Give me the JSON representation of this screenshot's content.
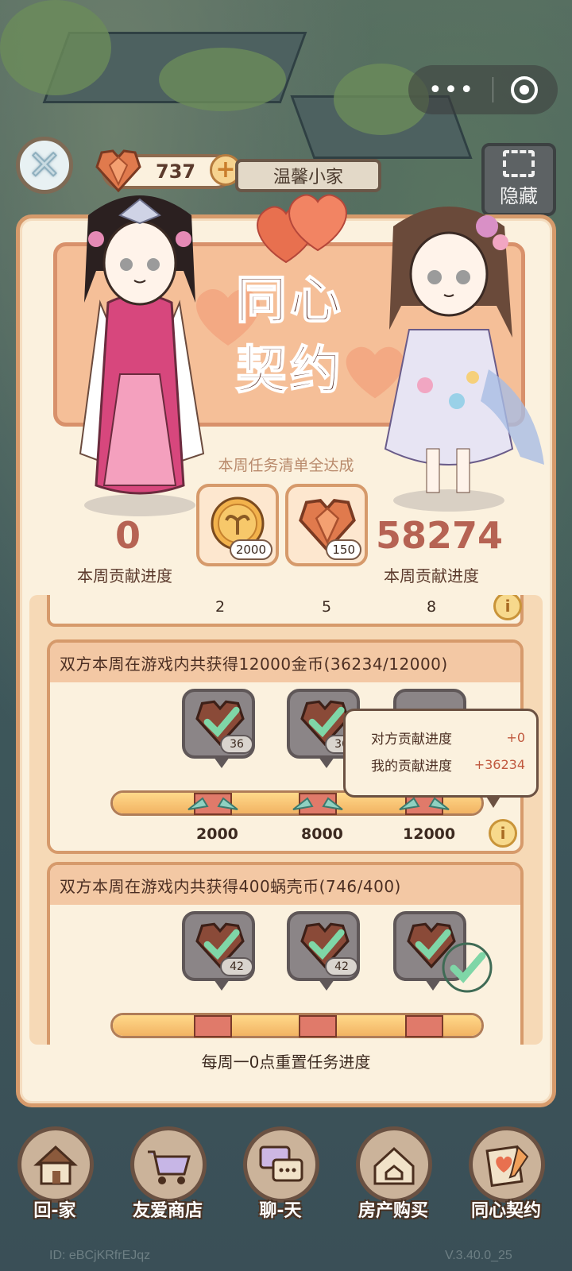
{
  "colors": {
    "panel_bg": "#fbf1de",
    "panel_border": "#d69a6b",
    "score_red": "#b66353",
    "check_green": "#7fd6a7"
  },
  "header": {
    "currency_value": "737",
    "house_name": "温馨小家",
    "hide_label": "隐藏"
  },
  "banner": {
    "title_line1": "同心",
    "title_line2": "契约"
  },
  "weekly": {
    "subtitle": "本周任务清单全达成",
    "rewards": [
      {
        "icon": "coin-icon",
        "count": "2000"
      },
      {
        "icon": "heart-gem-icon",
        "count": "150"
      }
    ],
    "left_score": "0",
    "left_label": "本周贡献进度",
    "right_score": "58274",
    "right_label": "本周贡献进度"
  },
  "previous_task": {
    "milestones": [
      "2",
      "5",
      "8"
    ]
  },
  "task1": {
    "title": "双方本周在游戏内共获得12000金币(36234/12000)",
    "slots": [
      {
        "badge": "36",
        "claimed": true
      },
      {
        "badge": "36",
        "claimed": true
      },
      {
        "badge": "",
        "claimed": true
      }
    ],
    "progress": 1.0,
    "milestones": [
      "2000",
      "8000",
      "12000"
    ]
  },
  "tooltip": {
    "partner_label": "对方贡献进度",
    "partner_value": "+0",
    "mine_label": "我的贡献进度",
    "mine_value": "+36234"
  },
  "task2": {
    "title": "双方本周在游戏内共获得400蜗壳币(746/400)",
    "slots": [
      {
        "badge": "42",
        "claimed": true
      },
      {
        "badge": "42",
        "claimed": true
      },
      {
        "badge": "",
        "claimed": true
      }
    ],
    "progress": 1.0
  },
  "footer_note": "每周一0点重置任务进度",
  "nav": [
    {
      "label": "回-家",
      "icon": "house-icon"
    },
    {
      "label": "友爱商店",
      "icon": "cart-icon"
    },
    {
      "label": "聊-天",
      "icon": "chat-icon"
    },
    {
      "label": "房产购买",
      "icon": "property-icon"
    },
    {
      "label": "同心契约",
      "icon": "contract-icon"
    }
  ],
  "footer": {
    "id": "ID:  eBCjKRfrEJqz",
    "version": "V.3.40.0_25"
  }
}
